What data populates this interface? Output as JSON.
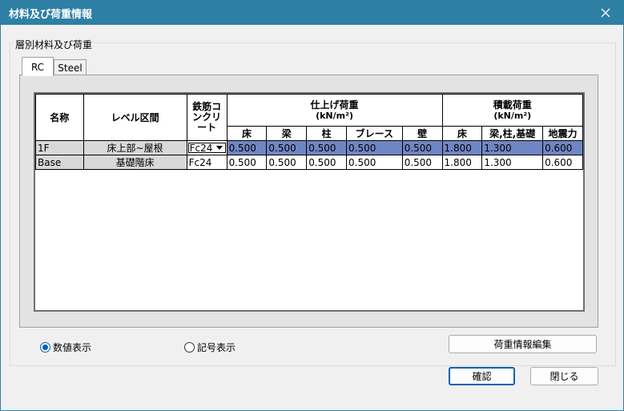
{
  "window": {
    "title": "材料及び荷重情報"
  },
  "group": {
    "label": "層別材料及び荷重"
  },
  "tabs": [
    {
      "label": "RC"
    },
    {
      "label": "Steel"
    }
  ],
  "grid": {
    "headers": {
      "name": "名称",
      "level": "レベル区間",
      "concrete": "鉄筋コンクリート",
      "finish_group": "仕上げ荷重",
      "finish_unit": "(kN/m²)",
      "live_group": "積載荷重",
      "live_unit": "(kN/m²)",
      "finish_cols": [
        "床",
        "梁",
        "柱",
        "ブレース",
        "壁"
      ],
      "live_cols": [
        "床",
        "梁,柱,基礎",
        "地震力"
      ]
    },
    "rows": [
      {
        "name": "1F",
        "level": "床上部~屋根",
        "concrete": "Fc24",
        "finish": [
          "0.500",
          "0.500",
          "0.500",
          "0.500",
          "0.500"
        ],
        "live": [
          "1.800",
          "1.300",
          "0.600"
        ],
        "selected": true
      },
      {
        "name": "Base",
        "level": "基礎階床",
        "concrete": "Fc24",
        "finish": [
          "0.500",
          "0.500",
          "0.500",
          "0.500",
          "0.500"
        ],
        "live": [
          "1.800",
          "1.300",
          "0.600"
        ],
        "selected": false
      }
    ]
  },
  "radios": {
    "numeric": "数値表示",
    "symbol": "記号表示",
    "selected": "numeric"
  },
  "buttons": {
    "edit_load": "荷重情報編集",
    "ok": "確認",
    "close": "閉じる"
  },
  "icons": {
    "close": "close-icon",
    "dropdown": "chevron-down-icon"
  },
  "colors": {
    "titlebar": "#2d7fa4",
    "selection": "#7086c4",
    "accent": "#005fb8"
  }
}
